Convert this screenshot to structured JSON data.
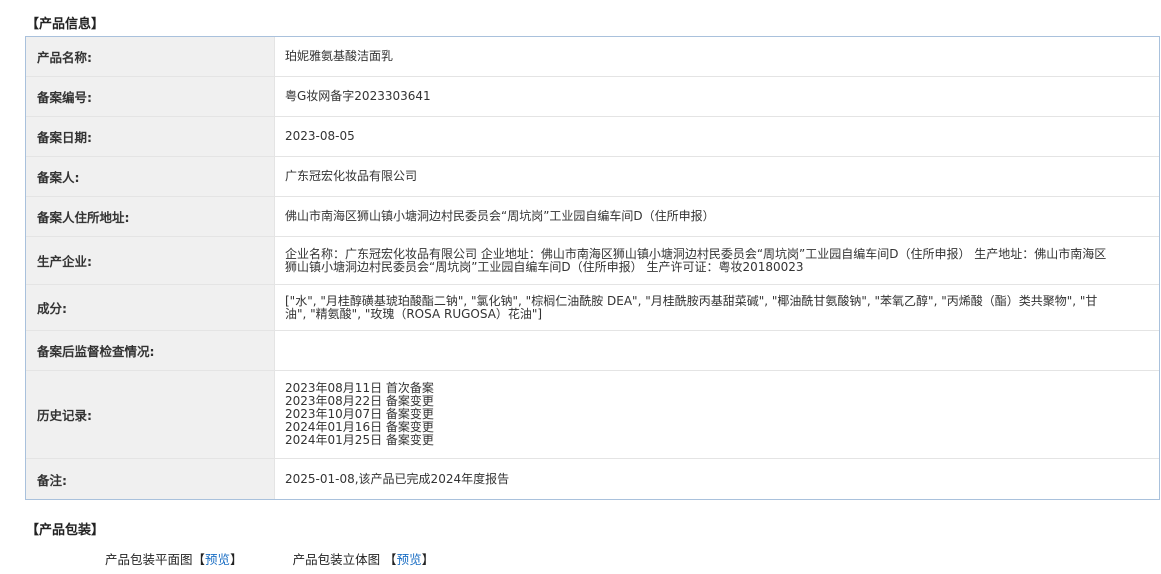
{
  "sections": {
    "info_title": "【产品信息】",
    "package_title": "【产品包装】"
  },
  "info": {
    "product_name": {
      "label": "产品名称:",
      "value": "珀妮雅氨基酸洁面乳"
    },
    "record_number": {
      "label": "备案编号:",
      "value": "粤G妆网备字2023303641"
    },
    "record_date": {
      "label": "备案日期:",
      "value": "2023-08-05"
    },
    "registrant": {
      "label": "备案人:",
      "value": "广东冠宏化妆品有限公司"
    },
    "registrant_address": {
      "label": "备案人住所地址:",
      "value": "佛山市南海区狮山镇小塘洞边村民委员会“周坑岗”工业园自编车间D（住所申报）"
    },
    "manufacturer": {
      "label": "生产企业:",
      "value": "企业名称：广东冠宏化妆品有限公司 企业地址：佛山市南海区狮山镇小塘洞边村民委员会“周坑岗”工业园自编车间D（住所申报） 生产地址：佛山市南海区狮山镇小塘洞边村民委员会“周坑岗”工业园自编车间D（住所申报） 生产许可证：粤妆20180023"
    },
    "ingredients": {
      "label": "成分:",
      "value": "[\"水\", \"月桂醇磺基琥珀酸酯二钠\", \"氯化钠\", \"棕榈仁油酰胺 DEA\", \"月桂酰胺丙基甜菜碱\", \"椰油酰甘氨酸钠\", \"苯氧乙醇\", \"丙烯酸（酯）类共聚物\", \"甘油\", \"精氨酸\", \"玫瑰（ROSA RUGOSA）花油\"]"
    },
    "post_inspection": {
      "label": "备案后监督检查情况:",
      "value": ""
    },
    "history": {
      "label": "历史记录:",
      "entries": [
        "2023年08月11日 首次备案",
        "2023年08月22日 备案变更",
        "2023年10月07日 备案变更",
        "2024年01月16日 备案变更",
        "2024年01月25日 备案变更"
      ]
    },
    "remarks": {
      "label": "备注:",
      "value": "2025-01-08,该产品已完成2024年度报告"
    }
  },
  "package": {
    "flat": {
      "label": "产品包装平面图",
      "bracket_open": "【",
      "link": "预览",
      "bracket_close": "】"
    },
    "solid": {
      "label": "产品包装立体图 ",
      "bracket_open": "【",
      "link": "预览",
      "bracket_close": "】"
    }
  }
}
